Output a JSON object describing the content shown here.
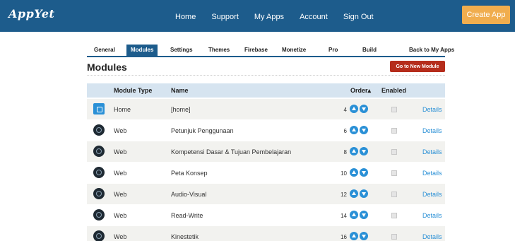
{
  "header": {
    "logo": "AppYet",
    "nav": [
      "Home",
      "Support",
      "My Apps",
      "Account",
      "Sign Out"
    ],
    "create_app": "Create App"
  },
  "tabs": [
    "General",
    "Modules",
    "Settings",
    "Themes",
    "Firebase",
    "Monetize",
    "Pro",
    "Build",
    "Back to My Apps"
  ],
  "active_tab": "Modules",
  "page_title": "Modules",
  "new_module_button": "Go to New Module",
  "table": {
    "headers": {
      "module_type": "Module Type",
      "name": "Name",
      "order": "Order▴",
      "enabled": "Enabled"
    },
    "rows": [
      {
        "icon": "home-icon",
        "type": "Home",
        "name": "[home]",
        "order": "4",
        "details": "Details"
      },
      {
        "icon": "web-module-icon",
        "type": "Web",
        "name": "Petunjuk Penggunaan",
        "order": "6",
        "details": "Details"
      },
      {
        "icon": "web-module-icon",
        "type": "Web",
        "name": "Kompetensi Dasar & Tujuan Pembelajaran",
        "order": "8",
        "details": "Details"
      },
      {
        "icon": "web-module-icon",
        "type": "Web",
        "name": "Peta Konsep",
        "order": "10",
        "details": "Details"
      },
      {
        "icon": "web-module-icon",
        "type": "Web",
        "name": "Audio-Visual",
        "order": "12",
        "details": "Details"
      },
      {
        "icon": "web-module-icon",
        "type": "Web",
        "name": "Read-Write",
        "order": "14",
        "details": "Details"
      },
      {
        "icon": "web-module-icon",
        "type": "Web",
        "name": "Kinestetik",
        "order": "16",
        "details": "Details"
      }
    ]
  },
  "colors": {
    "header_bg": "#1d5c8c",
    "accent": "#2a90d6",
    "create_app": "#f0ad4e",
    "new_module": "#b52d1c"
  }
}
